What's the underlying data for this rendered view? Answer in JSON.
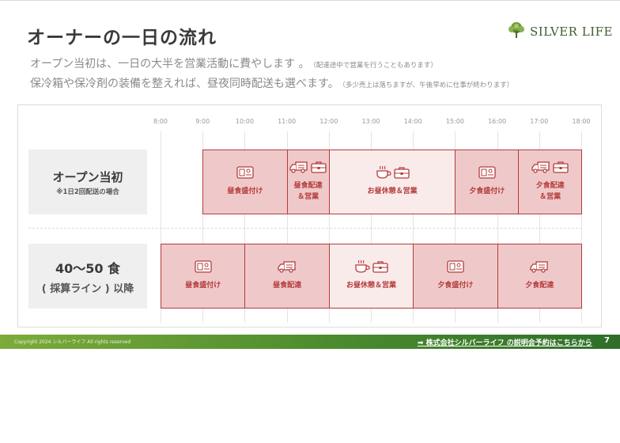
{
  "title": "オーナーの一日の流れ",
  "logo": {
    "text": "SILVER LIFE",
    "icon": "tree-logo-icon"
  },
  "subtitle": {
    "line1": "オープン当初は、一日の大半を営業活動に費やします 。",
    "line1_note": "（配達途中で営業を行うこともあります）",
    "line2": "保冷箱や保冷剤の装備を整えれば、昼夜同時配送も選べます。",
    "line2_note": "（多少売上は落ちますが、午後早めに仕事が終わります）"
  },
  "timeline": {
    "ticks": [
      "8:00",
      "9:00",
      "10:00",
      "11:00",
      "12:00",
      "13:00",
      "14:00",
      "15:00",
      "16:00",
      "17:00",
      "18:00"
    ]
  },
  "rows": [
    {
      "label": "オープン当初",
      "sublabel": "※1日2回配送の場合",
      "blocks": [
        {
          "start": 9,
          "end": 11,
          "label": "昼食盛付け",
          "icons": [
            "meal-box-icon"
          ],
          "shade": "dark"
        },
        {
          "start": 11,
          "end": 12,
          "label": "昼食配達\n＆営業",
          "icons": [
            "delivery-truck-icon",
            "briefcase-icon"
          ],
          "shade": "dark"
        },
        {
          "start": 12,
          "end": 15,
          "label": "お昼休憩＆営業",
          "icons": [
            "coffee-cup-icon",
            "briefcase-icon"
          ],
          "shade": "light"
        },
        {
          "start": 15,
          "end": 16.5,
          "label": "夕食盛付け",
          "icons": [
            "meal-box-icon"
          ],
          "shade": "dark"
        },
        {
          "start": 16.5,
          "end": 18,
          "label": "夕食配達\n＆営業",
          "icons": [
            "delivery-truck-icon",
            "briefcase-icon"
          ],
          "shade": "dark"
        }
      ]
    },
    {
      "label": "40〜50 食",
      "sublabel": "( 採算ライン ) 以降",
      "blocks": [
        {
          "start": 8,
          "end": 10,
          "label": "昼食盛付け",
          "icons": [
            "meal-box-icon"
          ],
          "shade": "dark"
        },
        {
          "start": 10,
          "end": 12,
          "label": "昼食配達",
          "icons": [
            "delivery-truck-icon"
          ],
          "shade": "dark"
        },
        {
          "start": 12,
          "end": 14,
          "label": "お昼休憩＆営業",
          "icons": [
            "coffee-cup-icon",
            "briefcase-icon"
          ],
          "shade": "light"
        },
        {
          "start": 14,
          "end": 16,
          "label": "夕食盛付け",
          "icons": [
            "meal-box-icon"
          ],
          "shade": "dark"
        },
        {
          "start": 16,
          "end": 18,
          "label": "夕食配達",
          "icons": [
            "delivery-truck-icon"
          ],
          "shade": "dark"
        }
      ]
    }
  ],
  "colors": {
    "accent": "#b53b3b",
    "block_dark": "#efc9c9",
    "block_light": "#faebeb",
    "footer_green": "#4a8b2e"
  },
  "footer": {
    "copyright": "Copyright 2024 シルバーライフ All rights reserved",
    "link": "➡ 株式会社シルバーライフ の説明会予約はこちらから",
    "page_number": "7"
  }
}
